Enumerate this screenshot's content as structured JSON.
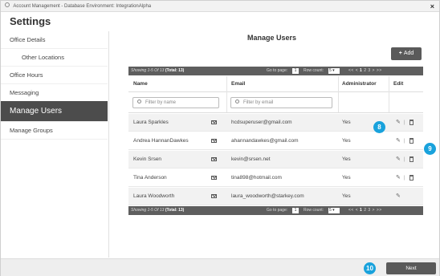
{
  "window": {
    "title": "Account Management - Database Environment: IntegrationAlpha",
    "close": "×"
  },
  "settings_heading": "Settings",
  "sidebar": {
    "items": [
      {
        "label": "Office Details"
      },
      {
        "label": "Other Locations"
      },
      {
        "label": "Office Hours"
      },
      {
        "label": "Messaging"
      },
      {
        "label": "Manage Users"
      },
      {
        "label": "Manage Groups"
      }
    ]
  },
  "main": {
    "title": "Manage Users",
    "add_label": "Add",
    "add_plus": "+"
  },
  "pager": {
    "showing_prefix": "Showing 1-5 Of 13",
    "total": "(Total: 13)",
    "goto_label": "Go to page:",
    "goto_value": "1",
    "rowcount_label": "Row count:",
    "rowcount_value": "5 ▾",
    "nav_prev": "<< <",
    "page_current": "1",
    "pages_rest": "2  3  >  >>"
  },
  "table": {
    "headers": [
      "Name",
      "Email",
      "Administrator",
      "Edit"
    ],
    "filter_name_placeholder": "Filter by name",
    "filter_email_placeholder": "Filter by email",
    "rows": [
      {
        "name": "Laura Sparkles",
        "email": "hcdsuperuser@gmail.com",
        "admin": "Yes"
      },
      {
        "name": "Andrea HannanDawkes",
        "email": "ahannandawkes@gmail.com",
        "admin": "Yes"
      },
      {
        "name": "Kevin Srsen",
        "email": "kevin@srsen.net",
        "admin": "Yes"
      },
      {
        "name": "Tina Anderson",
        "email": "tina898@hotmail.com",
        "admin": "Yes"
      },
      {
        "name": "Laura Woodworth",
        "email": "laura_woodworth@starkey.com",
        "admin": "Yes"
      }
    ]
  },
  "icons": {
    "edit": "✎",
    "separator": "|"
  },
  "badges": [
    "8",
    "9",
    "10"
  ],
  "footer": {
    "next_label": "Next"
  },
  "colors": {
    "active_nav": "#4c4c4c",
    "badge": "#19a2dc",
    "button": "#5a5a5a"
  }
}
